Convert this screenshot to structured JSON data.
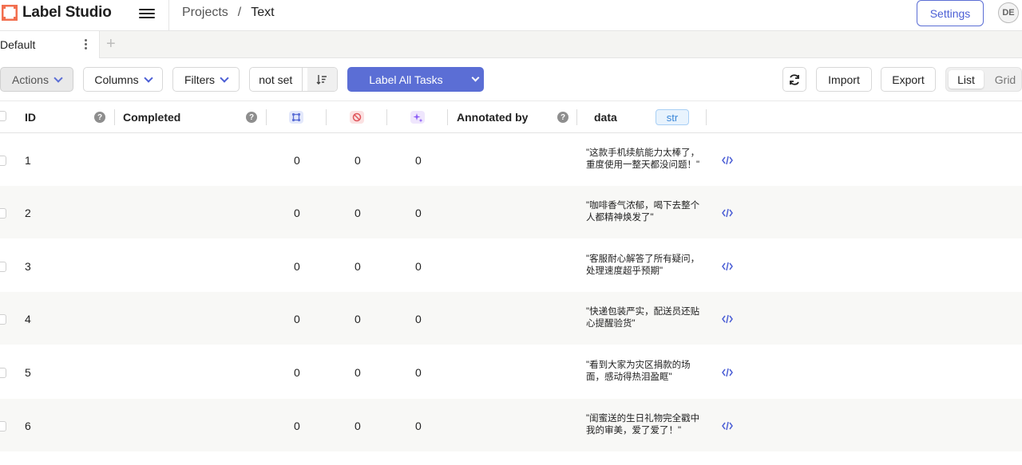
{
  "app": {
    "name": "Label Studio",
    "user_initials": "DE"
  },
  "breadcrumb": {
    "projects": "Projects",
    "separator": "/",
    "current": "Text"
  },
  "header": {
    "settings_label": "Settings"
  },
  "tabs": [
    {
      "label": "Default"
    }
  ],
  "toolbar": {
    "actions_label": "Actions",
    "columns_label": "Columns",
    "filters_label": "Filters",
    "order_label": "not set",
    "label_all_label": "Label All Tasks",
    "import_label": "Import",
    "export_label": "Export",
    "view_list": "List",
    "view_grid": "Grid"
  },
  "columns": {
    "id": "ID",
    "completed": "Completed",
    "annotated_by": "Annotated by",
    "data": "data",
    "data_type": "str",
    "help_glyph": "?"
  },
  "rows": [
    {
      "id": "1",
      "total": "0",
      "cancelled": "0",
      "predictions": "0",
      "text": "\"这款手机续航能力太棒了，重度使用一整天都没问题！\""
    },
    {
      "id": "2",
      "total": "0",
      "cancelled": "0",
      "predictions": "0",
      "text": "\"咖啡香气浓郁，喝下去整个人都精神焕发了\""
    },
    {
      "id": "3",
      "total": "0",
      "cancelled": "0",
      "predictions": "0",
      "text": "\"客服耐心解答了所有疑问，处理速度超乎预期\""
    },
    {
      "id": "4",
      "total": "0",
      "cancelled": "0",
      "predictions": "0",
      "text": "\"快递包装严实，配送员还贴心提醒验货\""
    },
    {
      "id": "5",
      "total": "0",
      "cancelled": "0",
      "predictions": "0",
      "text": "\"看到大家为灾区捐款的场面，感动得热泪盈眶\""
    },
    {
      "id": "6",
      "total": "0",
      "cancelled": "0",
      "predictions": "0",
      "text": "\"闺蜜送的生日礼物完全戳中我的审美，爱了爱了！\""
    }
  ],
  "colors": {
    "accent": "#5b6ed5",
    "logo": "#f26f4f",
    "str_badge": "#3a86d8",
    "cancelled_icon": "#e0555b",
    "prediction_icon": "#8b5cf6"
  }
}
